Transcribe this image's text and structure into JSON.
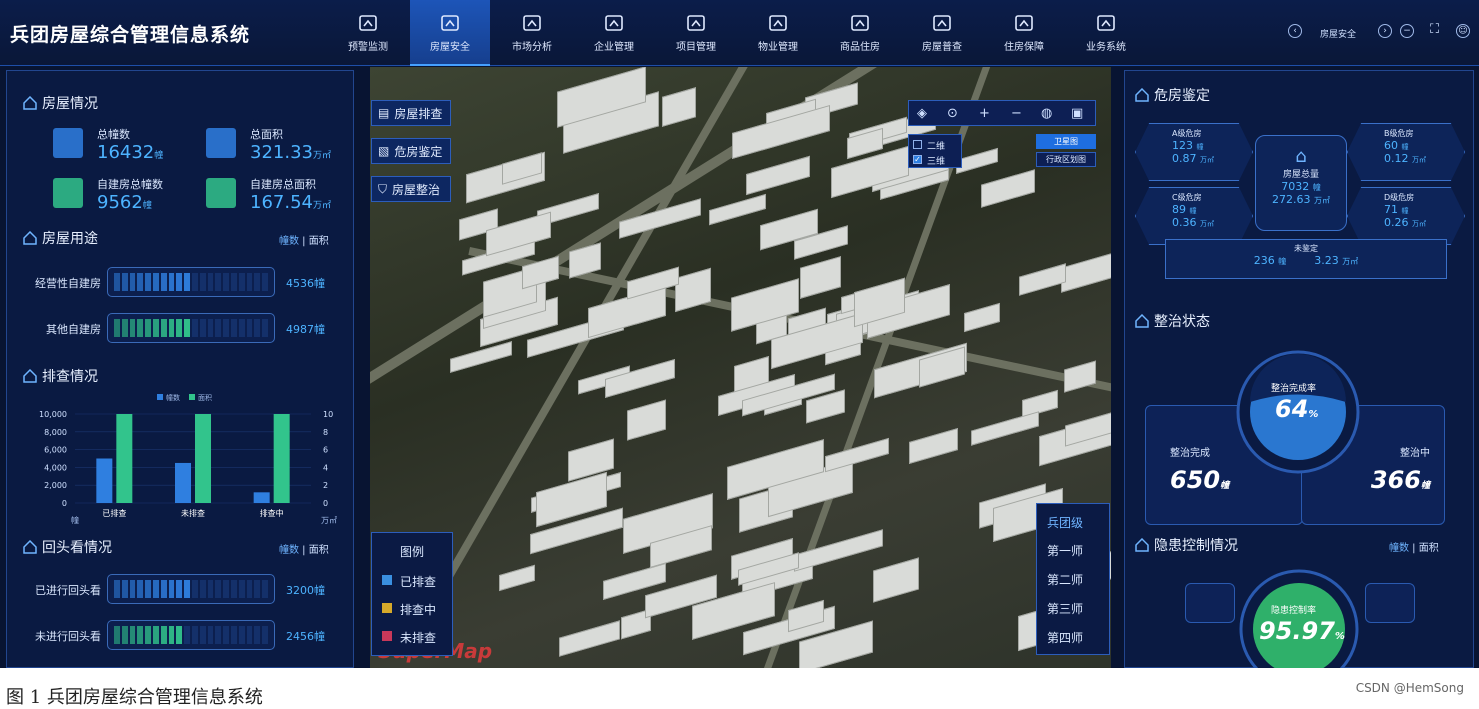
{
  "app_title": "兵团房屋综合管理信息系统",
  "nav": [
    {
      "label": "预警监测",
      "icon": "chart-icon"
    },
    {
      "label": "房屋安全",
      "icon": "house-shield-icon",
      "active": true
    },
    {
      "label": "市场分析",
      "icon": "market-icon"
    },
    {
      "label": "企业管理",
      "icon": "layers-icon"
    },
    {
      "label": "项目管理",
      "icon": "document-icon"
    },
    {
      "label": "物业管理",
      "icon": "tools-icon"
    },
    {
      "label": "商品住房",
      "icon": "home-icon"
    },
    {
      "label": "房屋普查",
      "icon": "house-search-icon"
    },
    {
      "label": "住房保障",
      "icon": "guarantee-icon"
    },
    {
      "label": "业务系统",
      "icon": "briefcase-icon"
    }
  ],
  "top_controls": {
    "current_label": "房屋安全"
  },
  "left": {
    "house_info": {
      "title": "房屋情况",
      "stats": [
        {
          "label": "总幢数",
          "value": "16432",
          "unit": "幢"
        },
        {
          "label": "总面积",
          "value": "321.33",
          "unit": "万㎡"
        },
        {
          "label": "自建房总幢数",
          "value": "9562",
          "unit": "幢"
        },
        {
          "label": "自建房总面积",
          "value": "167.54",
          "unit": "万㎡"
        }
      ]
    },
    "usage": {
      "title": "房屋用途",
      "toggle_a": "幢数",
      "toggle_b": "面积",
      "rows": [
        {
          "label": "经营性自建房",
          "value": "4536幢",
          "fill": 0.48,
          "color": "#2f7fe0"
        },
        {
          "label": "其他自建房",
          "value": "4987幢",
          "fill": 0.52,
          "color": "#32c48c"
        }
      ]
    },
    "survey": {
      "title": "排查情况",
      "legend_a": "幢数",
      "legend_b": "面积"
    },
    "revisit": {
      "title": "回头看情况",
      "toggle_a": "幢数",
      "toggle_b": "面积",
      "rows": [
        {
          "label": "已进行回头看",
          "value": "3200幢",
          "fill": 0.5,
          "color": "#2f7fe0"
        },
        {
          "label": "未进行回头看",
          "value": "2456幢",
          "fill": 0.43,
          "color": "#32c48c"
        }
      ]
    }
  },
  "chart_data": {
    "type": "bar",
    "categories": [
      "已排查",
      "未排查",
      "排查中"
    ],
    "series": [
      {
        "name": "幢数",
        "values": [
          5000,
          4500,
          1200
        ],
        "color": "#2f7fe0"
      },
      {
        "name": "面积",
        "values": [
          10,
          10,
          10
        ],
        "color": "#32c48c"
      }
    ],
    "ylim": [
      0,
      10000
    ],
    "y2lim": [
      0,
      10
    ],
    "yticks": [
      "10,000",
      "8,000",
      "6,000",
      "4,000",
      "2,000",
      "0"
    ],
    "y2ticks": [
      "10",
      "8",
      "6",
      "4",
      "2",
      "0"
    ],
    "ylabel": "幢",
    "y2label": "万㎡"
  },
  "map": {
    "side_buttons": [
      "房屋排查",
      "危房鉴定",
      "房屋整治"
    ],
    "layers": [
      "二维",
      "三维"
    ],
    "map_types": [
      "卫星图",
      "行政区划图"
    ],
    "legend_title": "图例",
    "legend": [
      {
        "label": "已排查",
        "color": "#3a8fe0"
      },
      {
        "label": "排查中",
        "color": "#d6a92a"
      },
      {
        "label": "未排查",
        "color": "#c8385a"
      }
    ],
    "division_title": "兵团级",
    "divisions": [
      "第一师",
      "第二师",
      "第三师",
      "第四师"
    ],
    "watermark": "SuperMap"
  },
  "right": {
    "danger": {
      "title": "危房鉴定",
      "center_label": "房屋总量",
      "center_count": "7032",
      "center_area": "272.63",
      "grades": [
        {
          "label": "A级危房",
          "count": "123",
          "area": "0.87"
        },
        {
          "label": "B级危房",
          "count": "60",
          "area": "0.12"
        },
        {
          "label": "C级危房",
          "count": "89",
          "area": "0.36"
        },
        {
          "label": "D级危房",
          "count": "71",
          "area": "0.26"
        }
      ],
      "unassessed_label": "未鉴定",
      "unassessed_count": "236",
      "unassessed_area": "3.23",
      "unit_count": "幢",
      "unit_area": "万㎡"
    },
    "rectify": {
      "title": "整治状态",
      "rate_label": "整治完成率",
      "rate": "64",
      "done_label": "整治完成",
      "done": "650",
      "doing_label": "整治中",
      "doing": "366",
      "unit": "幢"
    },
    "hazard": {
      "title": "隐患控制情况",
      "toggle_a": "幢数",
      "toggle_b": "面积",
      "rate_label": "隐患控制率",
      "rate": "95.97"
    }
  },
  "caption": "图 1 兵团房屋综合管理信息系统",
  "credit": "CSDN @HemSong"
}
